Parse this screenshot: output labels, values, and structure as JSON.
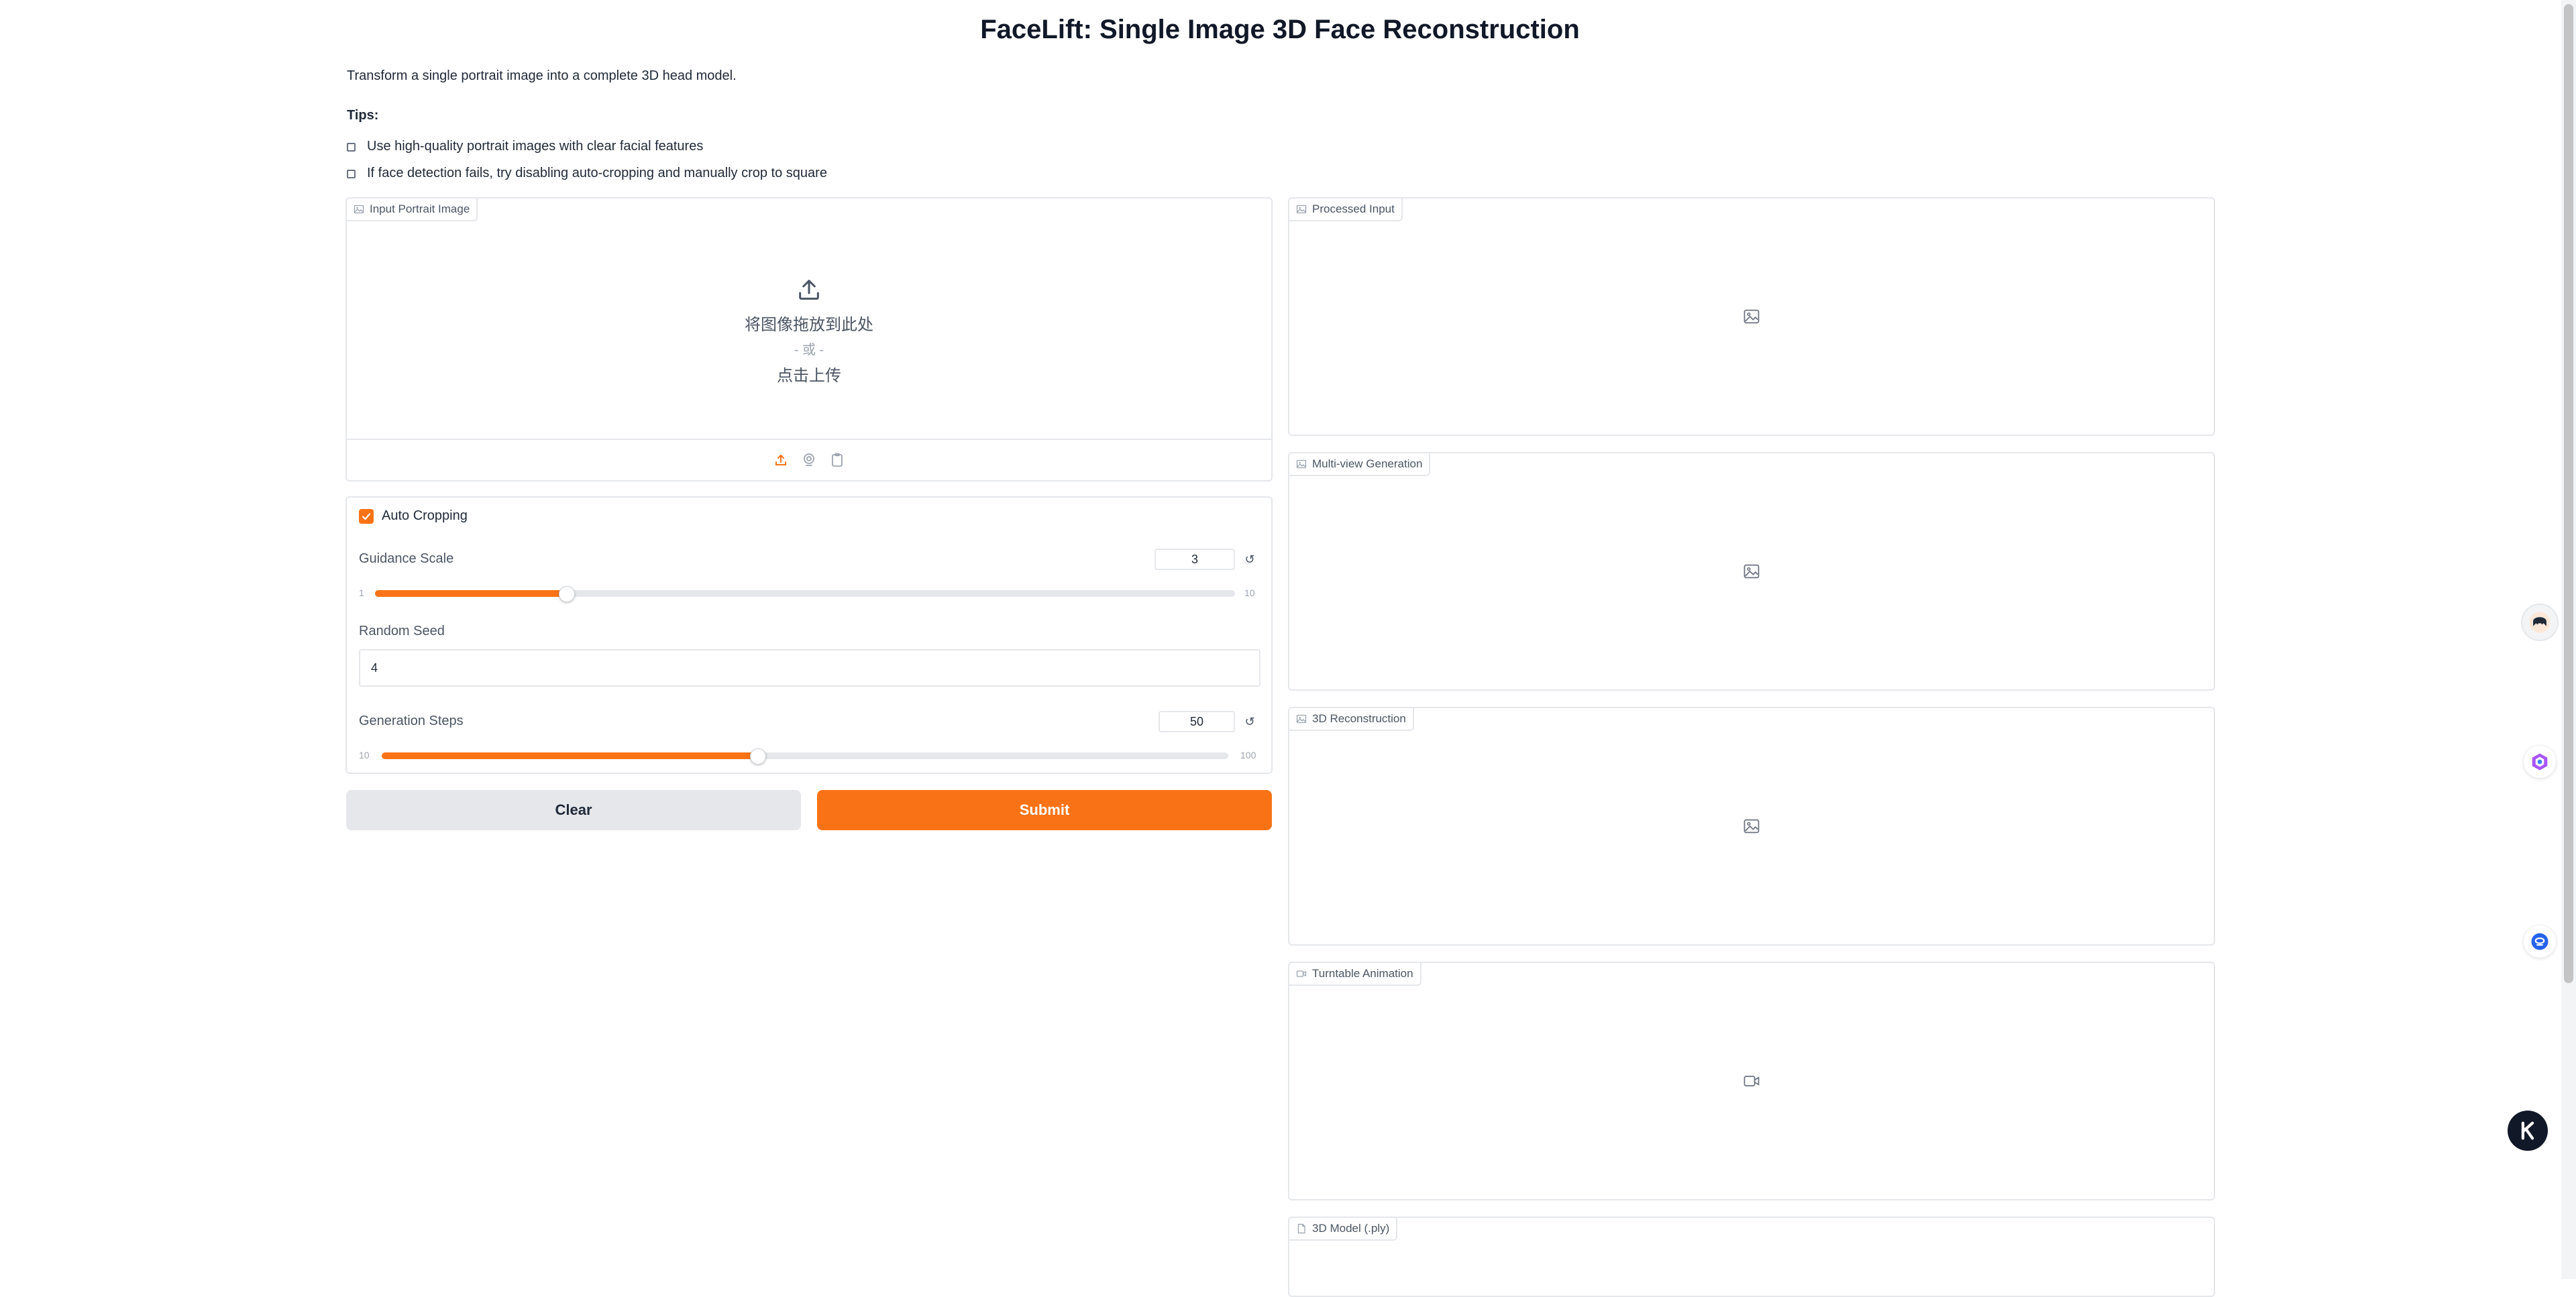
{
  "page": {
    "title": "FaceLift: Single Image 3D Face Reconstruction",
    "description": "Transform a single portrait image into a complete 3D head model.",
    "tips_heading": "Tips:",
    "tips": [
      "Use high-quality portrait images with clear facial features",
      "If face detection fails, try disabling auto-cropping and manually crop to square"
    ]
  },
  "input_panel": {
    "label": "Input Portrait Image",
    "drop_text": "将图像拖放到此处",
    "or_text": "- 或 -",
    "click_text": "点击上传",
    "sources": [
      "upload-icon",
      "webcam-icon",
      "clipboard-icon"
    ]
  },
  "controls": {
    "auto_cropping": {
      "label": "Auto Cropping",
      "checked": true
    },
    "guidance_scale": {
      "label": "Guidance Scale",
      "value": "3",
      "min": "1",
      "max": "10",
      "fraction": 0.222
    },
    "random_seed": {
      "label": "Random Seed",
      "value": "4"
    },
    "generation_steps": {
      "label": "Generation Steps",
      "value": "50",
      "min": "10",
      "max": "100",
      "fraction": 0.444
    }
  },
  "buttons": {
    "clear": "Clear",
    "submit": "Submit"
  },
  "outputs": [
    {
      "label": "Processed Input",
      "icon": "image-icon"
    },
    {
      "label": "Multi-view Generation",
      "icon": "image-icon"
    },
    {
      "label": "3D Reconstruction",
      "icon": "image-icon"
    },
    {
      "label": "Turntable Animation",
      "icon": "video-icon"
    },
    {
      "label": "3D Model (.ply)",
      "icon": "file-icon"
    }
  ],
  "colors": {
    "accent": "#f97316",
    "border": "#e5e7eb",
    "secondary_button": "#e5e7eb"
  }
}
